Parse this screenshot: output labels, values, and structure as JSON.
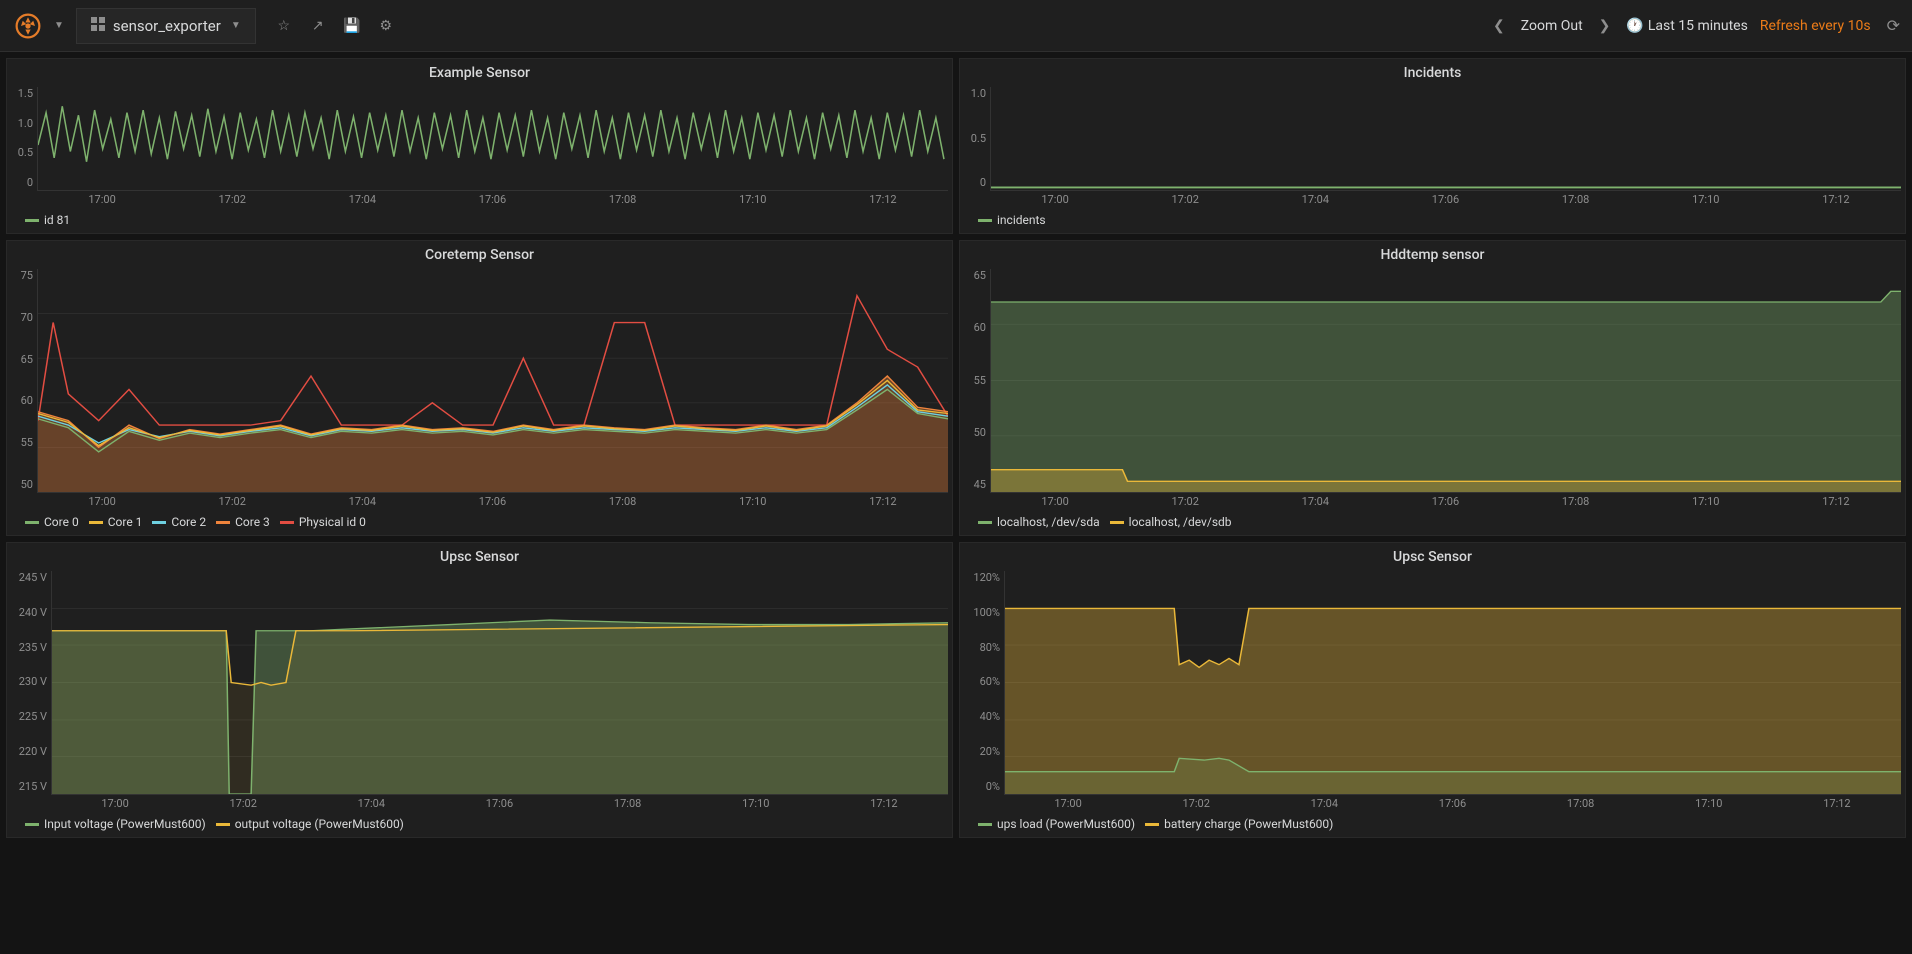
{
  "navbar": {
    "dashboard_title": "sensor_exporter",
    "zoom_out": "Zoom Out",
    "time_range": "Last 15 minutes",
    "refresh_label": "Refresh every 10s"
  },
  "x_ticks": [
    "17:00",
    "17:02",
    "17:04",
    "17:06",
    "17:08",
    "17:10",
    "17:12"
  ],
  "colors": {
    "green": "#7eb26d",
    "yellow": "#eab839",
    "cyan": "#6ed0e0",
    "orange": "#ef843c",
    "red": "#e24d42"
  },
  "panels": {
    "example": {
      "title": "Example Sensor",
      "y_ticks": [
        "1.5",
        "1.0",
        "0.5",
        "0"
      ],
      "legend": [
        {
          "label": "id 81",
          "color": "#7eb26d"
        }
      ]
    },
    "incidents": {
      "title": "Incidents",
      "y_ticks": [
        "1.0",
        "0.5",
        "0"
      ],
      "legend": [
        {
          "label": "incidents",
          "color": "#7eb26d"
        }
      ]
    },
    "coretemp": {
      "title": "Coretemp Sensor",
      "y_ticks": [
        "75",
        "70",
        "65",
        "60",
        "55",
        "50"
      ],
      "legend": [
        {
          "label": "Core 0",
          "color": "#7eb26d"
        },
        {
          "label": "Core 1",
          "color": "#eab839"
        },
        {
          "label": "Core 2",
          "color": "#6ed0e0"
        },
        {
          "label": "Core 3",
          "color": "#ef843c"
        },
        {
          "label": "Physical id 0",
          "color": "#e24d42"
        }
      ]
    },
    "hddtemp": {
      "title": "Hddtemp sensor",
      "y_ticks": [
        "65",
        "60",
        "55",
        "50",
        "45"
      ],
      "legend": [
        {
          "label": "localhost, /dev/sda",
          "color": "#7eb26d"
        },
        {
          "label": "localhost, /dev/sdb",
          "color": "#eab839"
        }
      ]
    },
    "upsc_voltage": {
      "title": "Upsc Sensor",
      "y_ticks": [
        "245 V",
        "240 V",
        "235 V",
        "230 V",
        "225 V",
        "220 V",
        "215 V"
      ],
      "legend": [
        {
          "label": "Input voltage (PowerMust600)",
          "color": "#7eb26d"
        },
        {
          "label": "output voltage (PowerMust600)",
          "color": "#eab839"
        }
      ]
    },
    "upsc_load": {
      "title": "Upsc Sensor",
      "y_ticks": [
        "120%",
        "100%",
        "80%",
        "60%",
        "40%",
        "20%",
        "0%"
      ],
      "legend": [
        {
          "label": "ups load (PowerMust600)",
          "color": "#7eb26d"
        },
        {
          "label": "battery charge (PowerMust600)",
          "color": "#eab839"
        }
      ]
    }
  },
  "chart_data": [
    {
      "type": "line",
      "title": "Example Sensor",
      "xlabel": "",
      "ylabel": "",
      "ylim": [
        0,
        1.5
      ],
      "x": [
        "16:59",
        "17:00",
        "17:01",
        "17:02",
        "17:03",
        "17:04",
        "17:05",
        "17:06",
        "17:07",
        "17:08",
        "17:09",
        "17:10",
        "17:11",
        "17:12",
        "17:13"
      ],
      "series": [
        {
          "name": "id 81",
          "note": "random oscillation between ~0.1 and ~1.0 sampled every 10s; dense noise"
        }
      ]
    },
    {
      "type": "line",
      "title": "Incidents",
      "xlabel": "",
      "ylabel": "",
      "ylim": [
        0,
        1.0
      ],
      "x": [
        "16:59",
        "17:00",
        "17:01",
        "17:02",
        "17:03",
        "17:04",
        "17:05",
        "17:06",
        "17:07",
        "17:08",
        "17:09",
        "17:10",
        "17:11",
        "17:12",
        "17:13"
      ],
      "series": [
        {
          "name": "incidents",
          "values": [
            0,
            0,
            0,
            0,
            0,
            0,
            0,
            0,
            0,
            0,
            0,
            0,
            0,
            0,
            0
          ]
        }
      ]
    },
    {
      "type": "area",
      "title": "Coretemp Sensor",
      "xlabel": "",
      "ylabel": "°C",
      "ylim": [
        50,
        75
      ],
      "x": [
        "16:59",
        "17:00",
        "17:01",
        "17:02",
        "17:03",
        "17:04",
        "17:05",
        "17:06",
        "17:07",
        "17:08",
        "17:09",
        "17:10",
        "17:11",
        "17:12",
        "17:13"
      ],
      "series": [
        {
          "name": "Core 0",
          "values": [
            58,
            57,
            55,
            56,
            56,
            57,
            56,
            56,
            57,
            56,
            56,
            57,
            56,
            60,
            59
          ]
        },
        {
          "name": "Core 1",
          "values": [
            59,
            58,
            56,
            57,
            56,
            57,
            57,
            56,
            57,
            57,
            56,
            57,
            57,
            61,
            59
          ]
        },
        {
          "name": "Core 2",
          "values": [
            58,
            57,
            56,
            56,
            57,
            56,
            56,
            57,
            56,
            56,
            57,
            56,
            57,
            60,
            58
          ]
        },
        {
          "name": "Core 3",
          "values": [
            59,
            58,
            56,
            57,
            57,
            58,
            57,
            57,
            57,
            57,
            57,
            58,
            57,
            62,
            60
          ]
        },
        {
          "name": "Physical id 0",
          "values": [
            69,
            62,
            58,
            58,
            63,
            58,
            58,
            65,
            58,
            69,
            69,
            58,
            58,
            72,
            65
          ]
        }
      ]
    },
    {
      "type": "area",
      "title": "Hddtemp sensor",
      "xlabel": "",
      "ylabel": "°C",
      "ylim": [
        45,
        65
      ],
      "x": [
        "16:59",
        "17:00",
        "17:01",
        "17:02",
        "17:03",
        "17:04",
        "17:05",
        "17:06",
        "17:07",
        "17:08",
        "17:09",
        "17:10",
        "17:11",
        "17:12",
        "17:13"
      ],
      "series": [
        {
          "name": "localhost, /dev/sda",
          "values": [
            62,
            62,
            62,
            62,
            62,
            62,
            62,
            62,
            62,
            62,
            62,
            62,
            62,
            62,
            63
          ]
        },
        {
          "name": "localhost, /dev/sdb",
          "values": [
            47,
            47,
            46,
            46,
            46,
            46,
            46,
            46,
            46,
            46,
            46,
            46,
            46,
            46,
            46
          ]
        }
      ]
    },
    {
      "type": "area",
      "title": "Upsc Sensor (voltage)",
      "xlabel": "",
      "ylabel": "V",
      "ylim": [
        215,
        245
      ],
      "x": [
        "16:59",
        "17:00",
        "17:01",
        "17:02",
        "17:03",
        "17:04",
        "17:05",
        "17:06",
        "17:07",
        "17:08",
        "17:09",
        "17:10",
        "17:11",
        "17:12",
        "17:13"
      ],
      "series": [
        {
          "name": "Input voltage (PowerMust600)",
          "values": [
            237,
            237,
            237,
            215,
            237,
            237,
            237,
            238,
            238,
            239,
            238,
            238,
            238,
            238,
            238
          ]
        },
        {
          "name": "output voltage (PowerMust600)",
          "values": [
            237,
            237,
            237,
            231,
            231,
            237,
            237,
            237,
            237,
            237,
            237,
            237,
            237,
            237,
            238
          ]
        }
      ]
    },
    {
      "type": "area",
      "title": "Upsc Sensor (load/charge)",
      "xlabel": "",
      "ylabel": "%",
      "ylim": [
        0,
        120
      ],
      "x": [
        "16:59",
        "17:00",
        "17:01",
        "17:02",
        "17:03",
        "17:04",
        "17:05",
        "17:06",
        "17:07",
        "17:08",
        "17:09",
        "17:10",
        "17:11",
        "17:12",
        "17:13"
      ],
      "series": [
        {
          "name": "ups load (PowerMust600)",
          "values": [
            12,
            12,
            12,
            19,
            19,
            12,
            12,
            12,
            12,
            12,
            12,
            12,
            12,
            12,
            12
          ]
        },
        {
          "name": "battery charge (PowerMust600)",
          "values": [
            100,
            100,
            100,
            70,
            72,
            100,
            100,
            100,
            100,
            100,
            100,
            100,
            100,
            100,
            100
          ]
        }
      ]
    }
  ]
}
